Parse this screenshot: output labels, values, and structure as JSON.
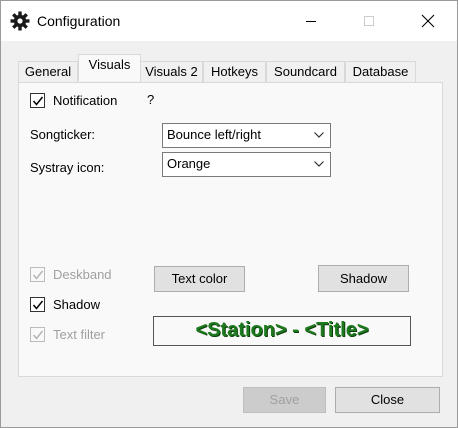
{
  "window": {
    "title": "Configuration"
  },
  "tabs": [
    {
      "label": "General",
      "active": false
    },
    {
      "label": "Visuals",
      "active": true
    },
    {
      "label": "Visuals 2",
      "active": false
    },
    {
      "label": "Hotkeys",
      "active": false
    },
    {
      "label": "Soundcard",
      "active": false
    },
    {
      "label": "Database",
      "active": false
    }
  ],
  "visuals": {
    "notification": {
      "label": "Notification",
      "checked": true,
      "help": "?"
    },
    "songticker": {
      "label": "Songticker:",
      "value": "Bounce left/right"
    },
    "systray": {
      "label": "Systray icon:",
      "value": "Orange"
    },
    "deskband": {
      "label": "Deskband",
      "checked": true,
      "enabled": false
    },
    "shadow": {
      "label": "Shadow",
      "checked": true,
      "enabled": true
    },
    "text_filter": {
      "label": "Text filter",
      "checked": true,
      "enabled": false
    },
    "text_color_button": "Text color",
    "shadow_button": "Shadow",
    "preview_text": "<Station> - <Title>",
    "preview_color": "#1e7a1e"
  },
  "footer": {
    "save_label": "Save",
    "close_label": "Close"
  }
}
